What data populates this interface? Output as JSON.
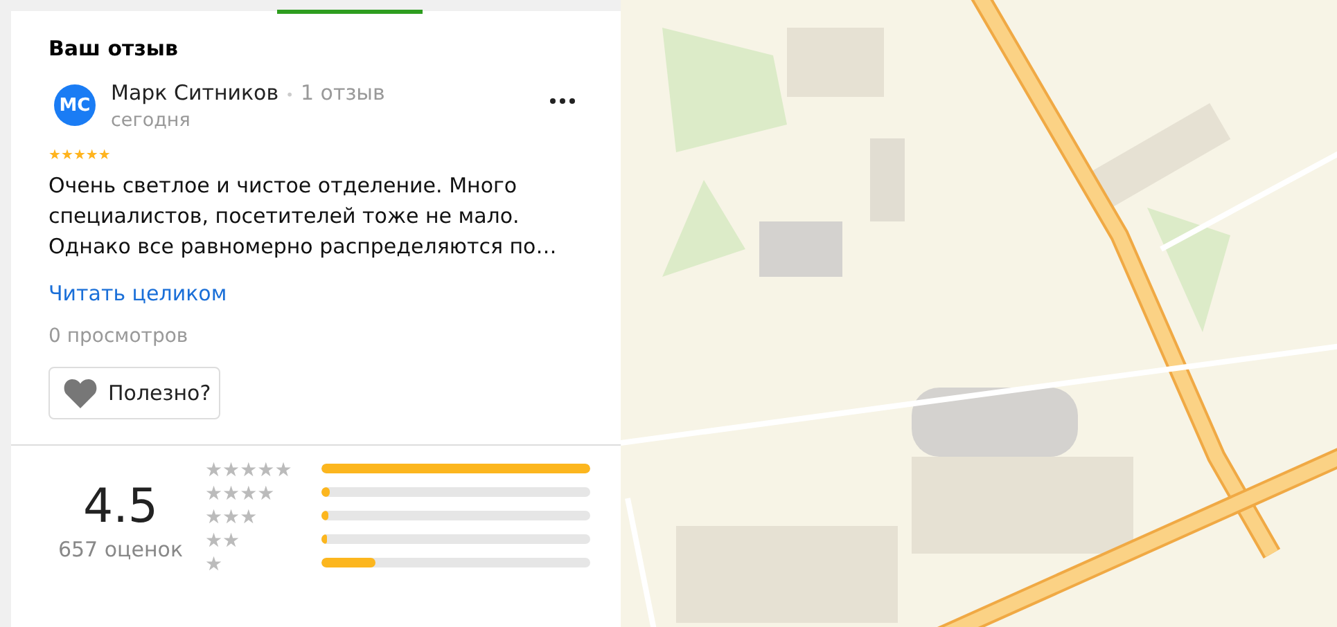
{
  "section_title": "Ваш отзыв",
  "review": {
    "initials": "МС",
    "author": "Марк Ситников",
    "separator": "•",
    "review_count": "1 отзыв",
    "date": "сегодня",
    "stars": 5,
    "text": "Очень светлое и чистое отделение. Много специалистов, посетителей тоже не мало. Однако все равномерно распределяются по…",
    "read_more": "Читать целиком",
    "views": "0 просмотров",
    "useful_button": "Полезно?"
  },
  "summary": {
    "score": "4.5",
    "ratings_count": "657 оценок"
  },
  "distribution": [
    {
      "label": "★★★★★",
      "level": 1.0
    },
    {
      "label": "★★★★",
      "level": 0.03
    },
    {
      "label": "★★★",
      "level": 0.025
    },
    {
      "label": "★★",
      "level": 0.015
    },
    {
      "label": "★",
      "level": 0.2
    }
  ]
}
